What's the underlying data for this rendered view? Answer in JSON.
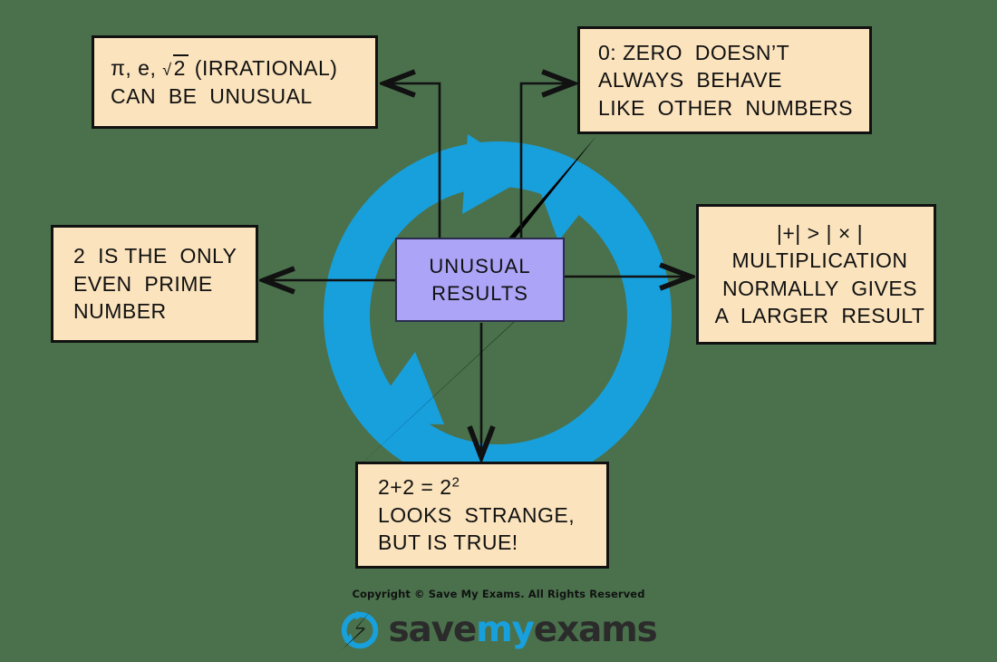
{
  "page": {
    "background_color": "#4a714c",
    "box_fill": "#fae3bd",
    "center_fill": "#aba4f7",
    "accent_blue": "#18a0dd",
    "ink": "#111111"
  },
  "center": {
    "name": "unusual-results",
    "line1": "UNUSUAL",
    "line2": "RESULTS"
  },
  "boxes": {
    "irrational": {
      "line1_prefix": "π, e, ",
      "line1_sqrt_radicand": "2",
      "line1_suffix": " (IRRATIONAL)",
      "line2": "CAN  BE  UNUSUAL"
    },
    "zero": {
      "line1": "0: ZERO  DOESN’T",
      "line2": "ALWAYS  BEHAVE",
      "line3": "LIKE  OTHER  NUMBERS"
    },
    "even_prime": {
      "line1": "2  IS THE  ONLY",
      "line2": "EVEN  PRIME",
      "line3": "NUMBER"
    },
    "multiplication": {
      "line1": "|+| > | × |",
      "line2": "MULTIPLICATION",
      "line3": "NORMALLY  GIVES",
      "line4": "A  LARGER  RESULT"
    },
    "two_plus_two": {
      "line1_base": "2+2 = 2",
      "line1_exponent": "2",
      "line2": "LOOKS  STRANGE,",
      "line3": "BUT IS TRUE!"
    }
  },
  "footer": {
    "copyright": "Copyright © Save My Exams. All Rights Reserved",
    "brand_part1": "save",
    "brand_part2": "my",
    "brand_part3": "exams"
  }
}
